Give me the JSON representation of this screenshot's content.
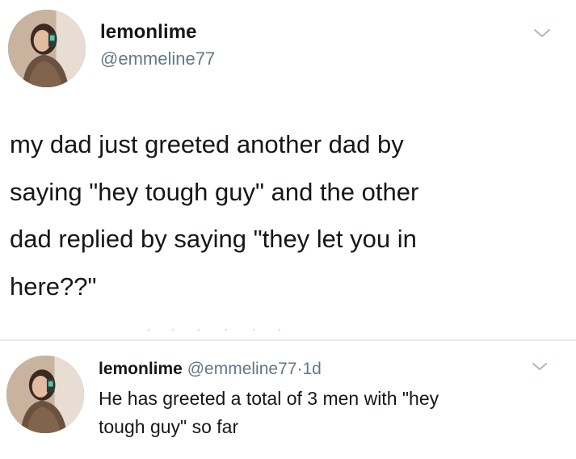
{
  "main_tweet": {
    "display_name": "lemonlime",
    "handle": "@emmeline77",
    "text_lines": [
      "my dad just greeted another dad by",
      "saying \"hey tough guy\" and the other",
      "dad replied by saying \"they let you in",
      "here??\""
    ],
    "menu_icon": "chevron-down-icon"
  },
  "reply_tweet": {
    "display_name": "lemonlime",
    "handle": "@emmeline77",
    "separator": "·",
    "time": "1d",
    "text_lines": [
      "He has greeted a total of 3 men with \"hey",
      "tough guy\" so far"
    ],
    "menu_icon": "chevron-down-icon"
  },
  "colors": {
    "text": "#14171a",
    "secondary": "#657786",
    "divider": "#e6ecf0"
  }
}
